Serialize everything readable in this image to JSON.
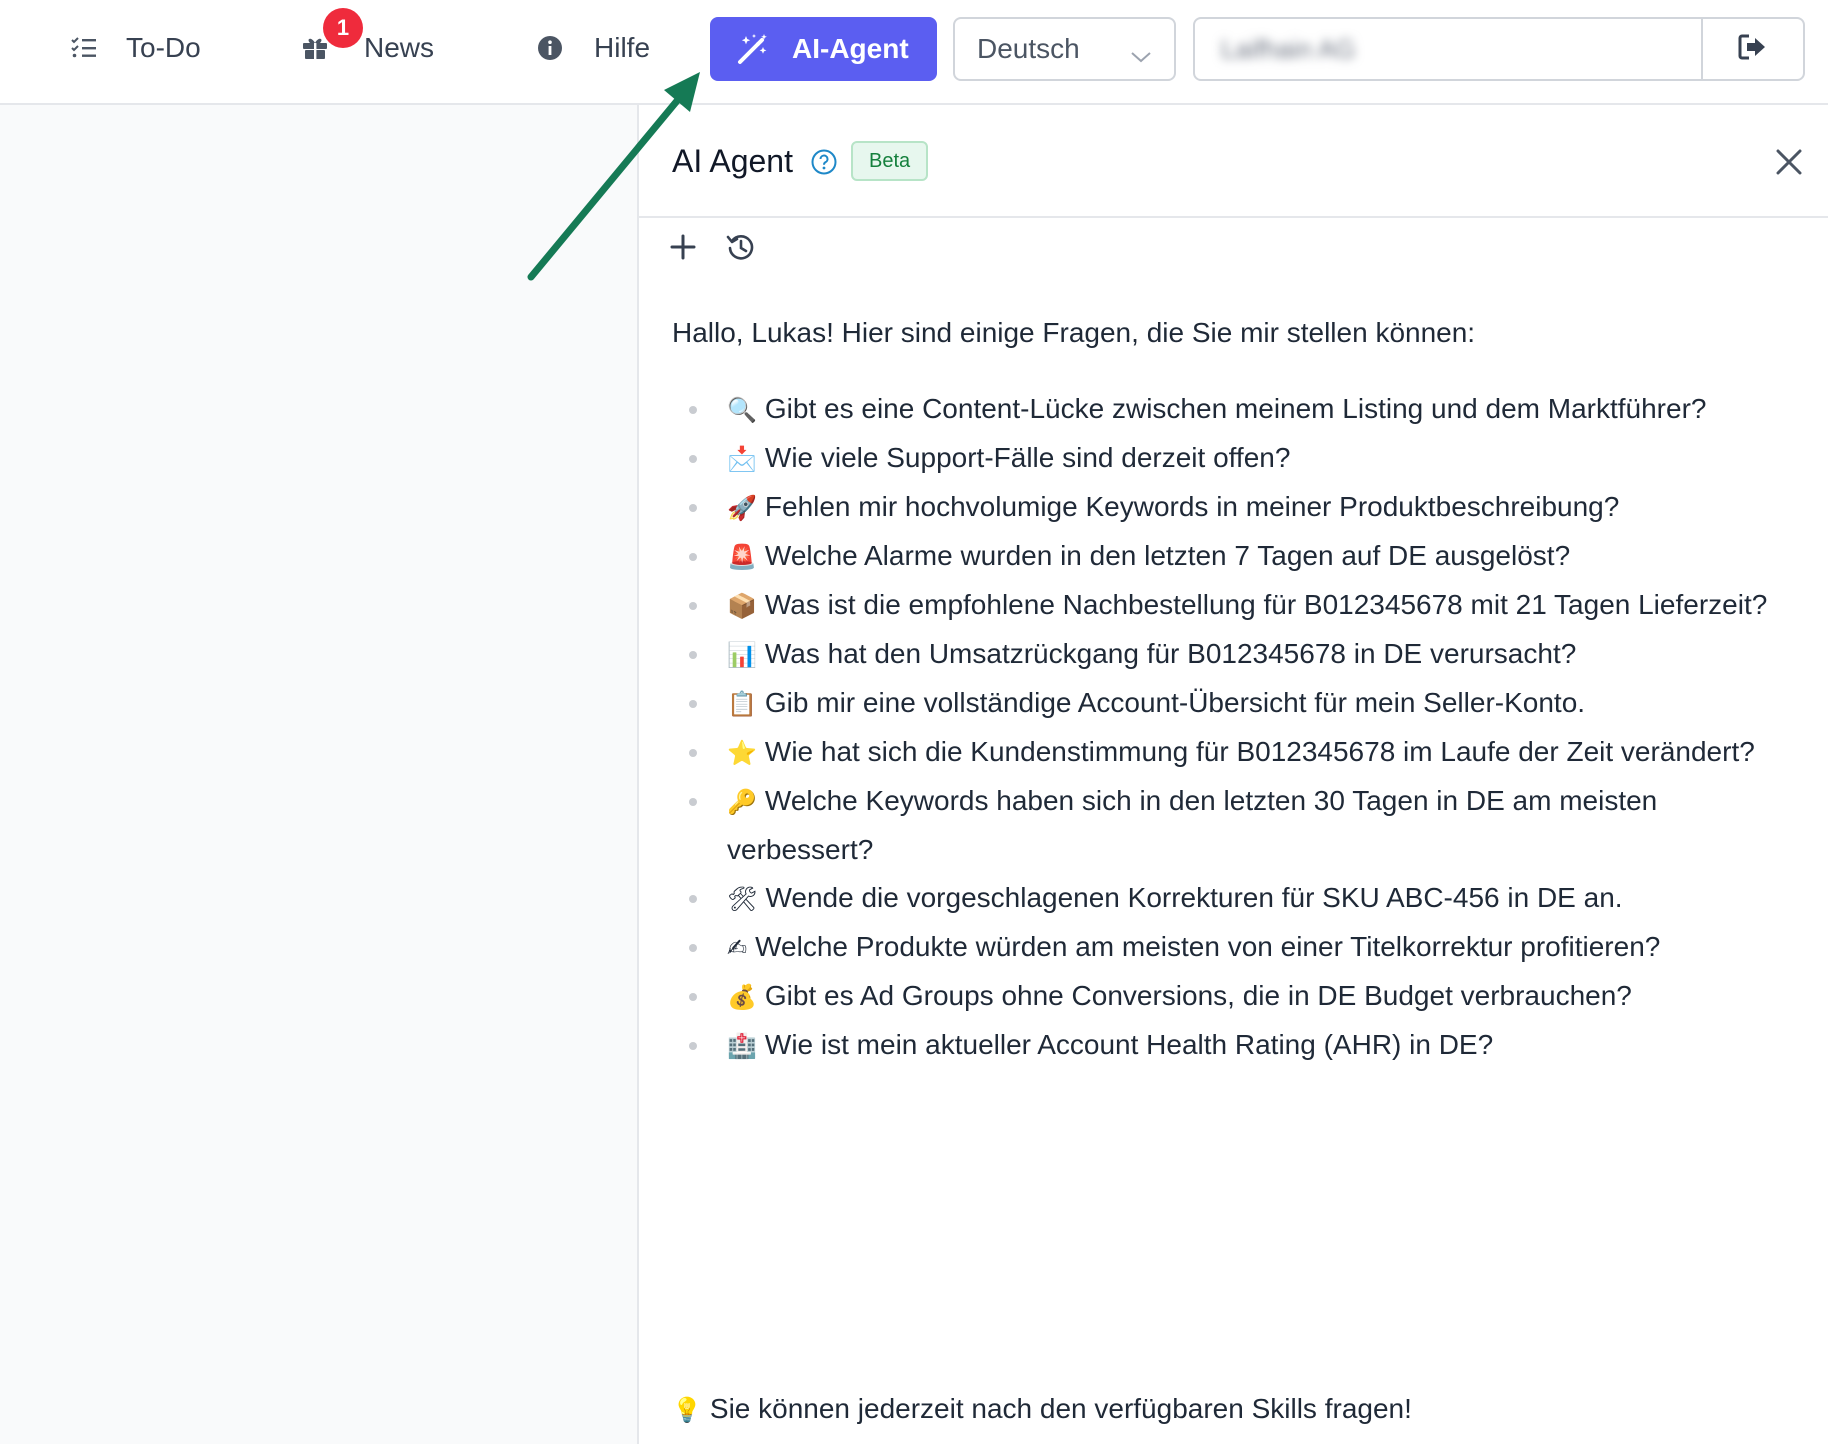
{
  "nav": {
    "todo": {
      "label": "To-Do",
      "icon": "list-check-icon"
    },
    "news": {
      "label": "News",
      "icon": "gift-icon",
      "badge": "1"
    },
    "hilfe": {
      "label": "Hilfe",
      "icon": "info-icon"
    }
  },
  "ai_button": {
    "label": "AI-Agent",
    "icon": "magic-wand-icon",
    "color": "#5b5ef1"
  },
  "language": {
    "selected": "Deutsch"
  },
  "account": {
    "name": "Laifhain AG"
  },
  "panel": {
    "title": "AI Agent",
    "badge": "Beta",
    "greeting": "Hallo, Lukas! Hier sind einige Fragen, die Sie mir stellen können:",
    "suggestions": [
      {
        "emoji": "🔍",
        "text": "Gibt es eine Content-Lücke zwischen meinem Listing und dem Marktführer?"
      },
      {
        "emoji": "📩",
        "text": "Wie viele Support-Fälle sind derzeit offen?"
      },
      {
        "emoji": "🚀",
        "text": "Fehlen mir hochvolumige Keywords in meiner Produktbeschreibung?"
      },
      {
        "emoji": "🚨",
        "text": "Welche Alarme wurden in den letzten 7 Tagen auf DE ausgelöst?"
      },
      {
        "emoji": "📦",
        "text": "Was ist die empfohlene Nachbestellung für B012345678 mit 21 Tagen Lieferzeit?"
      },
      {
        "emoji": "📊",
        "text": "Was hat den Umsatzrückgang für B012345678 in DE verursacht?"
      },
      {
        "emoji": "📋",
        "text": "Gib mir eine vollständige Account-Übersicht für mein Seller-Konto."
      },
      {
        "emoji": "⭐",
        "text": "Wie hat sich die Kundenstimmung für B012345678 im Laufe der Zeit verändert?"
      },
      {
        "emoji": "🔑",
        "text": "Welche Keywords haben sich in den letzten 30 Tagen in DE am meisten verbessert?"
      },
      {
        "emoji": "🛠",
        "text": "Wende die vorgeschlagenen Korrekturen für SKU ABC-456 in DE an."
      },
      {
        "emoji": "✍",
        "text": "Welche Produkte würden am meisten von einer Titelkorrektur profitieren?"
      },
      {
        "emoji": "💰",
        "text": "Gibt es Ad Groups ohne Conversions, die in DE Budget verbrauchen?"
      },
      {
        "emoji": "🏥",
        "text": "Wie ist mein aktueller Account Health Rating (AHR) in DE?"
      }
    ],
    "tip": {
      "emoji": "💡",
      "text": "Sie können jederzeit nach den verfügbaren Skills fragen!"
    }
  },
  "annotation": {
    "arrow_color": "#157a55"
  }
}
